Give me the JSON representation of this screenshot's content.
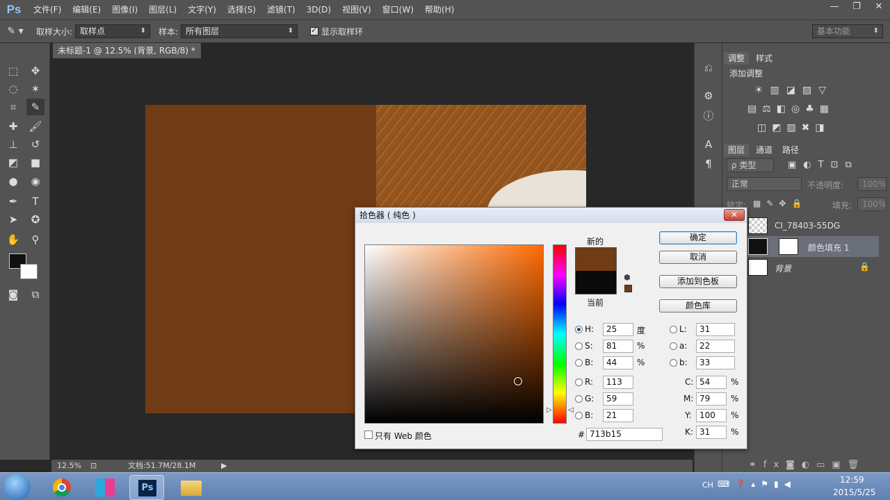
{
  "menubar": {
    "logo": "Ps",
    "items": [
      "文件(F)",
      "编辑(E)",
      "图像(I)",
      "图层(L)",
      "文字(Y)",
      "选择(S)",
      "滤镜(T)",
      "3D(D)",
      "视图(V)",
      "窗口(W)",
      "帮助(H)"
    ]
  },
  "optbar": {
    "sample_size_label": "取样大小:",
    "sample_size_value": "取样点",
    "sample_label": "样本:",
    "sample_value": "所有图层",
    "show_ring_label": "显示取样环",
    "workspace": "基本功能"
  },
  "document": {
    "tab_title": "未标题-1 @ 12.5% (背景, RGB/8) *",
    "zoom": "12.5%",
    "doc_size": "文档:51.7M/28.1M"
  },
  "panels": {
    "adjust_tab": "调整",
    "style_tab": "样式",
    "add_adjust": "添加调整",
    "layers_tab": "图层",
    "channels_tab": "通道",
    "paths_tab": "路径",
    "kind_filter": "ρ 类型",
    "blend_mode": "正常",
    "opacity_label": "不透明度:",
    "opacity_value": "100%",
    "lock_label": "锁定:",
    "fill_label": "填充:",
    "fill_value": "100%",
    "layers": [
      {
        "name": "CI_78403-55DG"
      },
      {
        "name": "颜色填充 1"
      },
      {
        "name": "背景"
      }
    ]
  },
  "dialog": {
    "title": "拾色器 ( 纯色 )",
    "close": "✕",
    "new_label": "新的",
    "current_label": "当前",
    "ok": "确定",
    "cancel": "取消",
    "add_swatch": "添加到色板",
    "color_lib": "颜色库",
    "web_only": "只有 Web 颜色",
    "new_color": "#713b15",
    "current_color": "#0a0a0a",
    "hsb": {
      "H": "25",
      "S": "81",
      "B": "44",
      "H_unit": "度",
      "S_unit": "%",
      "B_unit": "%"
    },
    "rgb": {
      "R": "113",
      "G": "59",
      "B": "21"
    },
    "lab": {
      "L": "31",
      "a": "22",
      "b": "33"
    },
    "cmyk": {
      "C": "54",
      "M": "79",
      "Y": "100",
      "K": "31",
      "unit": "%"
    },
    "hex": "713b15",
    "labels": {
      "H": "H:",
      "S": "S:",
      "B": "B:",
      "R": "R:",
      "G": "G:",
      "B2": "B:",
      "L": "L:",
      "a": "a:",
      "b": "b:",
      "C": "C:",
      "M": "M:",
      "Y": "Y:",
      "K": "K:",
      "hash": "#"
    }
  },
  "taskbar": {
    "lang": "CH",
    "time": "12:59",
    "date": "2015/5/25"
  }
}
